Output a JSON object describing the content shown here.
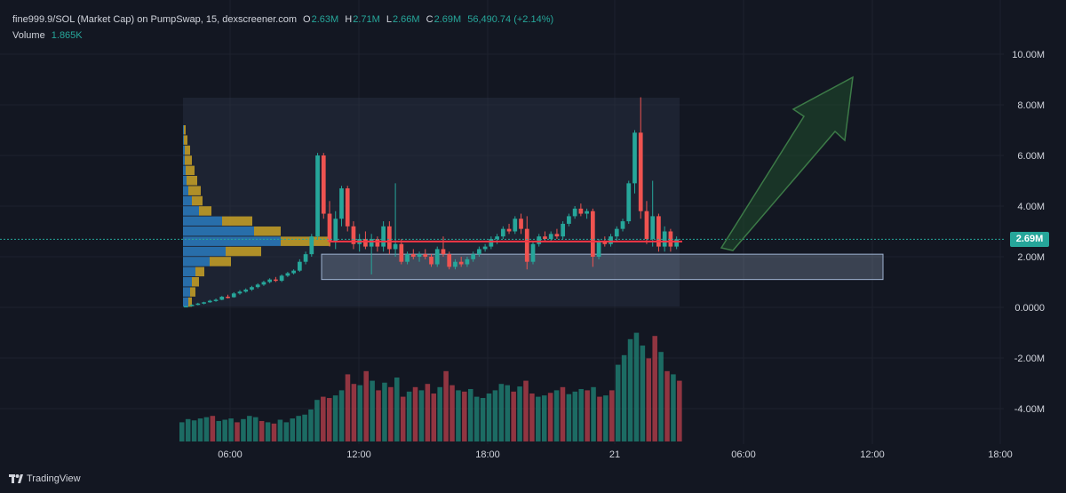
{
  "header": {
    "symbol": "fine999.9/SOL (Market Cap) on PumpSwap, 15, dexscreener.com",
    "o_label": "O",
    "o_value": "2.63M",
    "h_label": "H",
    "h_value": "2.71M",
    "l_label": "L",
    "l_value": "2.66M",
    "c_label": "C",
    "c_value": "2.69M",
    "change": "56,490.74 (+2.14%)",
    "volume_label": "Volume",
    "volume_value": "1.865K"
  },
  "price_badge": "2.69M",
  "brand": "TradingView",
  "colors": {
    "up": "#26a69a",
    "down": "#ef5350",
    "background": "#131722",
    "highlight_line": "#f23645",
    "arrow": "#2e6b3a"
  },
  "chart_data": {
    "type": "candlestick",
    "y_ticks": [
      "10.00M",
      "8.00M",
      "6.00M",
      "4.00M",
      "2.00M",
      "0.0000",
      "-2.00M",
      "-4.00M"
    ],
    "y_tick_values": [
      10,
      8,
      6,
      4,
      2,
      0,
      -2,
      -4
    ],
    "y_unit": "M",
    "x_ticks": [
      "06:00",
      "12:00",
      "18:00",
      "21",
      "06:00",
      "12:00",
      "18:00"
    ],
    "horizontal_line": 2.6,
    "support_zone": [
      1.1,
      2.1
    ],
    "candles": [
      [
        0.0,
        0.05,
        0.0,
        0.05
      ],
      [
        0.05,
        0.12,
        0.04,
        0.1
      ],
      [
        0.1,
        0.18,
        0.08,
        0.15
      ],
      [
        0.15,
        0.22,
        0.12,
        0.2
      ],
      [
        0.2,
        0.3,
        0.18,
        0.26
      ],
      [
        0.26,
        0.35,
        0.22,
        0.3
      ],
      [
        0.3,
        0.45,
        0.28,
        0.42
      ],
      [
        0.42,
        0.5,
        0.35,
        0.4
      ],
      [
        0.4,
        0.6,
        0.38,
        0.55
      ],
      [
        0.55,
        0.68,
        0.5,
        0.62
      ],
      [
        0.62,
        0.75,
        0.58,
        0.7
      ],
      [
        0.7,
        0.85,
        0.65,
        0.8
      ],
      [
        0.8,
        0.95,
        0.75,
        0.9
      ],
      [
        0.9,
        1.05,
        0.85,
        1.0
      ],
      [
        1.0,
        1.15,
        0.95,
        1.1
      ],
      [
        1.1,
        1.2,
        1.0,
        1.05
      ],
      [
        1.05,
        1.3,
        1.0,
        1.25
      ],
      [
        1.25,
        1.4,
        1.2,
        1.35
      ],
      [
        1.35,
        1.5,
        1.3,
        1.45
      ],
      [
        1.45,
        1.9,
        1.4,
        1.8
      ],
      [
        1.8,
        2.2,
        1.7,
        2.1
      ],
      [
        2.1,
        2.9,
        2.0,
        2.8
      ],
      [
        2.8,
        6.1,
        2.7,
        6.0
      ],
      [
        6.0,
        6.1,
        3.5,
        3.7
      ],
      [
        3.7,
        4.2,
        2.4,
        2.6
      ],
      [
        2.6,
        3.8,
        2.3,
        3.5
      ],
      [
        3.5,
        4.8,
        3.2,
        4.7
      ],
      [
        4.7,
        4.8,
        3.0,
        3.2
      ],
      [
        3.2,
        3.4,
        2.3,
        2.5
      ],
      [
        2.5,
        2.9,
        2.2,
        2.7
      ],
      [
        2.7,
        3.0,
        2.3,
        2.4
      ],
      [
        2.4,
        2.9,
        1.3,
        2.7
      ],
      [
        2.7,
        2.8,
        2.2,
        2.4
      ],
      [
        2.4,
        3.4,
        2.2,
        3.2
      ],
      [
        3.2,
        3.4,
        2.1,
        2.3
      ],
      [
        2.3,
        4.9,
        2.0,
        2.5
      ],
      [
        2.5,
        2.7,
        1.7,
        1.8
      ],
      [
        1.8,
        2.2,
        1.7,
        2.1
      ],
      [
        2.1,
        2.3,
        1.9,
        2.0
      ],
      [
        2.0,
        2.2,
        1.8,
        2.1
      ],
      [
        2.1,
        2.3,
        1.9,
        2.0
      ],
      [
        2.0,
        2.1,
        1.6,
        1.7
      ],
      [
        1.7,
        2.4,
        1.6,
        2.3
      ],
      [
        2.3,
        2.8,
        2.0,
        2.1
      ],
      [
        2.1,
        2.2,
        1.5,
        1.6
      ],
      [
        1.6,
        1.9,
        1.5,
        1.8
      ],
      [
        1.8,
        2.0,
        1.6,
        1.7
      ],
      [
        1.7,
        2.0,
        1.6,
        1.9
      ],
      [
        1.9,
        2.2,
        1.8,
        2.1
      ],
      [
        2.1,
        2.4,
        2.0,
        2.3
      ],
      [
        2.3,
        2.5,
        2.2,
        2.4
      ],
      [
        2.4,
        2.8,
        2.3,
        2.7
      ],
      [
        2.7,
        2.9,
        2.5,
        2.8
      ],
      [
        2.8,
        3.2,
        2.7,
        3.1
      ],
      [
        3.1,
        3.3,
        2.9,
        3.0
      ],
      [
        3.0,
        3.6,
        2.9,
        3.5
      ],
      [
        3.5,
        3.7,
        2.9,
        3.1
      ],
      [
        3.1,
        3.6,
        1.5,
        1.8
      ],
      [
        1.8,
        2.6,
        1.7,
        2.5
      ],
      [
        2.5,
        2.9,
        2.4,
        2.8
      ],
      [
        2.8,
        3.0,
        2.6,
        2.7
      ],
      [
        2.7,
        3.0,
        2.6,
        2.9
      ],
      [
        2.9,
        3.1,
        2.7,
        2.8
      ],
      [
        2.8,
        3.4,
        2.7,
        3.3
      ],
      [
        3.3,
        3.7,
        3.2,
        3.6
      ],
      [
        3.6,
        4.0,
        3.5,
        3.9
      ],
      [
        3.9,
        4.1,
        3.6,
        3.7
      ],
      [
        3.7,
        3.9,
        3.5,
        3.8
      ],
      [
        3.8,
        3.9,
        1.6,
        2.0
      ],
      [
        2.0,
        2.7,
        1.9,
        2.6
      ],
      [
        2.6,
        2.8,
        2.4,
        2.5
      ],
      [
        2.5,
        2.9,
        2.4,
        2.8
      ],
      [
        2.8,
        3.2,
        2.6,
        3.1
      ],
      [
        3.1,
        3.5,
        3.0,
        3.4
      ],
      [
        3.4,
        5.0,
        3.3,
        4.9
      ],
      [
        4.9,
        7.0,
        4.5,
        6.9
      ],
      [
        6.9,
        8.3,
        3.5,
        3.8
      ],
      [
        3.8,
        4.2,
        2.5,
        2.7
      ],
      [
        2.7,
        5.0,
        2.4,
        3.6
      ],
      [
        3.6,
        3.7,
        2.2,
        2.4
      ],
      [
        2.4,
        3.2,
        2.2,
        3.0
      ],
      [
        3.0,
        3.1,
        2.2,
        2.4
      ],
      [
        2.4,
        2.8,
        2.3,
        2.69
      ]
    ],
    "volumes": [
      30,
      35,
      33,
      36,
      38,
      40,
      32,
      34,
      36,
      30,
      35,
      40,
      38,
      32,
      30,
      28,
      34,
      30,
      36,
      40,
      42,
      50,
      65,
      70,
      68,
      72,
      80,
      105,
      90,
      88,
      110,
      95,
      80,
      92,
      85,
      100,
      70,
      78,
      85,
      80,
      90,
      75,
      85,
      110,
      88,
      80,
      78,
      82,
      70,
      68,
      75,
      80,
      90,
      88,
      78,
      86,
      95,
      75,
      70,
      72,
      76,
      80,
      85,
      74,
      78,
      82,
      80,
      85,
      70,
      72,
      80,
      120,
      135,
      160,
      170,
      150,
      130,
      165,
      140,
      110,
      105,
      95
    ],
    "volume_up": [
      true,
      true,
      true,
      true,
      true,
      false,
      true,
      true,
      true,
      false,
      true,
      true,
      true,
      false,
      true,
      false,
      true,
      true,
      true,
      true,
      true,
      true,
      true,
      false,
      false,
      true,
      true,
      false,
      false,
      true,
      false,
      true,
      false,
      true,
      false,
      true,
      false,
      true,
      false,
      true,
      false,
      false,
      true,
      false,
      false,
      true,
      false,
      true,
      true,
      true,
      true,
      true,
      true,
      true,
      false,
      true,
      false,
      false,
      true,
      true,
      false,
      true,
      false,
      true,
      true,
      true,
      false,
      true,
      false,
      true,
      false,
      true,
      true,
      true,
      true,
      true,
      false,
      false,
      true,
      false,
      true,
      false,
      true
    ],
    "profile": [
      {
        "price": 0.2,
        "up": 6,
        "down": 4
      },
      {
        "price": 0.6,
        "up": 8,
        "down": 6
      },
      {
        "price": 1.0,
        "up": 10,
        "down": 8
      },
      {
        "price": 1.4,
        "up": 14,
        "down": 10
      },
      {
        "price": 1.8,
        "up": 30,
        "down": 24
      },
      {
        "price": 2.2,
        "up": 48,
        "down": 40
      },
      {
        "price": 2.6,
        "up": 110,
        "down": 56
      },
      {
        "price": 3.0,
        "up": 80,
        "down": 30
      },
      {
        "price": 3.4,
        "up": 44,
        "down": 34
      },
      {
        "price": 3.8,
        "up": 18,
        "down": 14
      },
      {
        "price": 4.2,
        "up": 10,
        "down": 12
      },
      {
        "price": 4.6,
        "up": 6,
        "down": 14
      },
      {
        "price": 5.0,
        "up": 4,
        "down": 12
      },
      {
        "price": 5.4,
        "up": 3,
        "down": 10
      },
      {
        "price": 5.8,
        "up": 2,
        "down": 8
      },
      {
        "price": 6.2,
        "up": 2,
        "down": 6
      },
      {
        "price": 6.6,
        "up": 1,
        "down": 4
      },
      {
        "price": 7.0,
        "up": 1,
        "down": 2
      }
    ]
  }
}
